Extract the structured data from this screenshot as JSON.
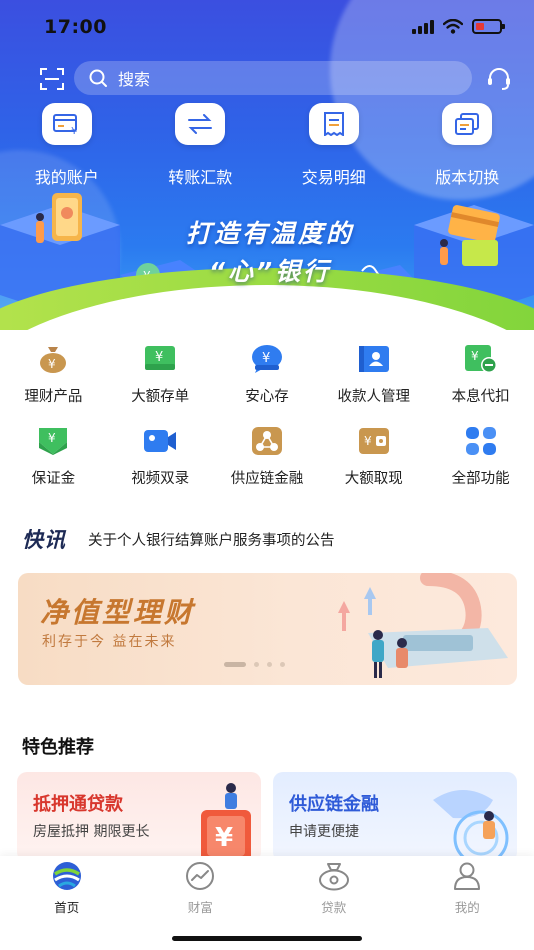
{
  "status": {
    "time": "17:00"
  },
  "search": {
    "placeholder": "搜索"
  },
  "quick_actions": [
    {
      "label": "我的账户",
      "icon": "card-yen-icon"
    },
    {
      "label": "转账汇款",
      "icon": "transfer-arrows-icon"
    },
    {
      "label": "交易明细",
      "icon": "receipt-icon"
    },
    {
      "label": "版本切换",
      "icon": "switch-version-icon"
    }
  ],
  "slogan": {
    "line1": "打造有温度的",
    "line2": "“心”银行"
  },
  "functions": [
    {
      "label": "理财产品",
      "icon": "money-bag-icon",
      "color": "#c9974f"
    },
    {
      "label": "大额存单",
      "icon": "deposit-wallet-icon",
      "color": "#3fbf5f"
    },
    {
      "label": "安心存",
      "icon": "yen-chat-icon",
      "color": "#2f7cf0"
    },
    {
      "label": "收款人管理",
      "icon": "payee-contact-icon",
      "color": "#2f7cf0"
    },
    {
      "label": "本息代扣",
      "icon": "yen-minus-icon",
      "color": "#3fbf5f"
    },
    {
      "label": "保证金",
      "icon": "yen-download-icon",
      "color": "#3fbf5f"
    },
    {
      "label": "视频双录",
      "icon": "video-camera-icon",
      "color": "#2f7cf0"
    },
    {
      "label": "供应链金融",
      "icon": "supply-chain-icon",
      "color": "#c9974f"
    },
    {
      "label": "大额取现",
      "icon": "cash-withdraw-icon",
      "color": "#c9974f"
    },
    {
      "label": "全部功能",
      "icon": "all-functions-grid-icon",
      "color": "#2f7cf0"
    }
  ],
  "news": {
    "tag": "快讯",
    "text": "关于个人银行结算账户服务事项的公告"
  },
  "banner": {
    "title": "净值型理财",
    "subtitle": "利存于今 益在未来",
    "active_dot": 0,
    "dot_count": 4
  },
  "featured": {
    "title": "特色推荐",
    "cards": [
      {
        "title": "抵押通贷款",
        "subtitle": "房屋抵押 期限更长"
      },
      {
        "title": "供应链金融",
        "subtitle": "申请更便捷"
      }
    ]
  },
  "tabs": [
    {
      "label": "首页",
      "icon": "home-logo-icon",
      "active": true
    },
    {
      "label": "财富",
      "icon": "wealth-chart-icon",
      "active": false
    },
    {
      "label": "贷款",
      "icon": "loan-bag-icon",
      "active": false
    },
    {
      "label": "我的",
      "icon": "profile-person-icon",
      "active": false
    }
  ],
  "colors": {
    "brand_blue": "#2f63e8",
    "news_tag": "#1d2a55",
    "banner_title": "#c7772f",
    "card_red": "#d8372d",
    "card_blue": "#2f5bd8"
  }
}
